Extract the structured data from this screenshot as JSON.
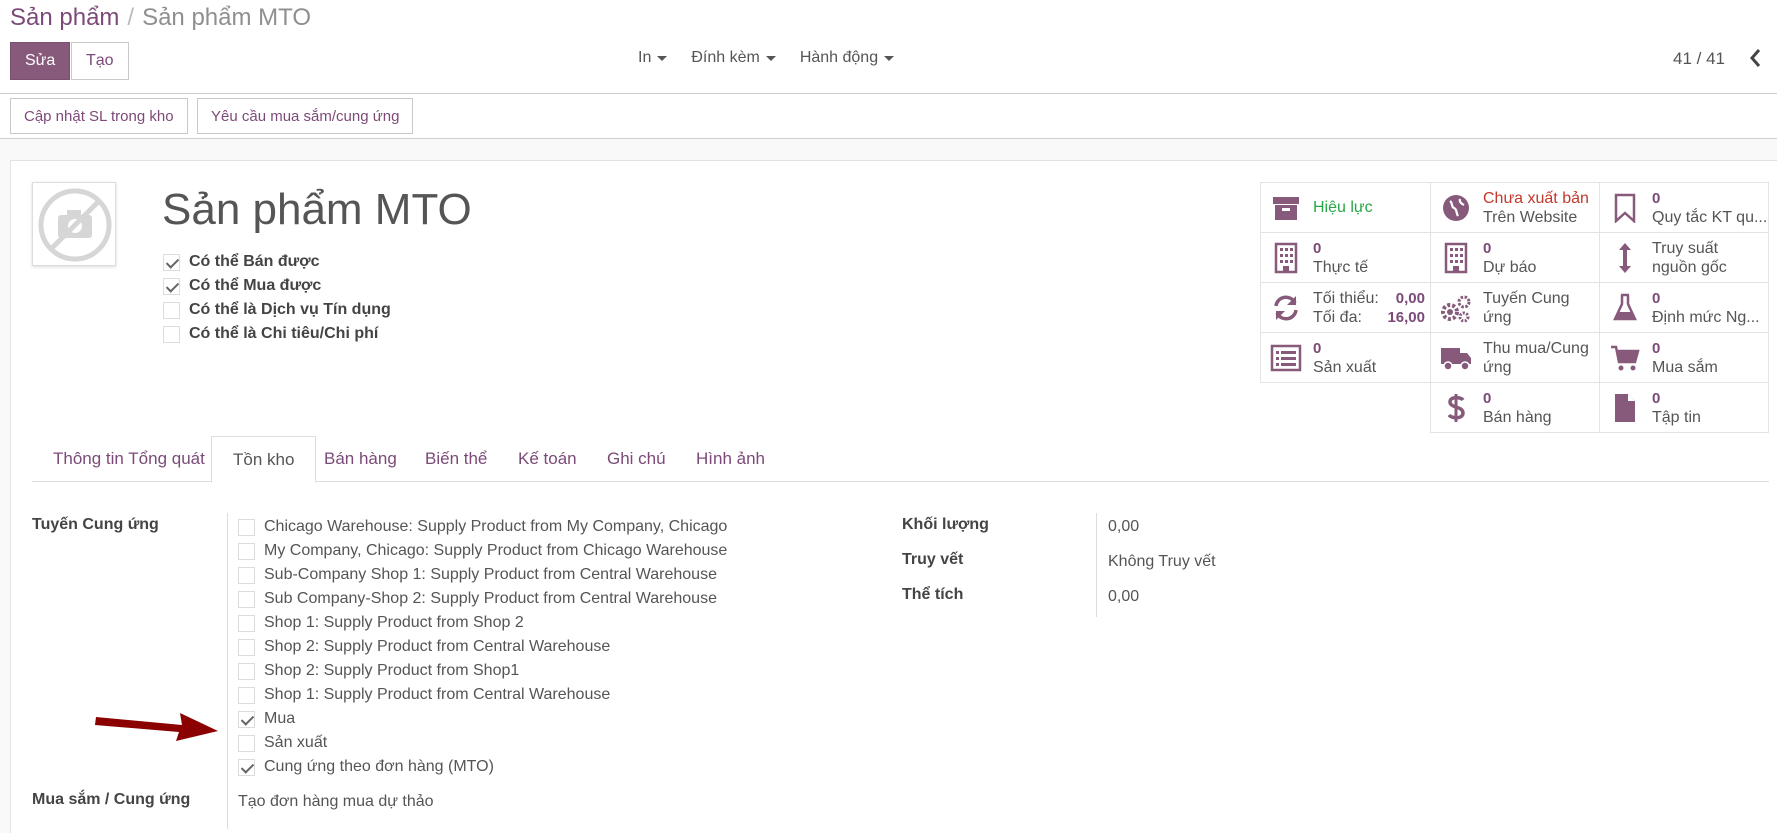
{
  "breadcrumb": {
    "parent": "Sản phẩm",
    "separator": "/",
    "current": "Sản phẩm MTO"
  },
  "toolbar": {
    "edit_label": "Sửa",
    "create_label": "Tạo"
  },
  "dropdowns": {
    "print": "In",
    "attachment": "Đính kèm",
    "action": "Hành động"
  },
  "pager": {
    "text": "41 / 41"
  },
  "status_buttons": {
    "update_qty": "Cập nhật SL trong kho",
    "procurement_request": "Yêu cầu mua sắm/cung ứng"
  },
  "product": {
    "name": "Sản phẩm MTO",
    "options": [
      {
        "label": "Có thể Bán được",
        "checked": true
      },
      {
        "label": "Có thể Mua được",
        "checked": true
      },
      {
        "label": "Có thể là Dịch vụ Tín dụng",
        "checked": false
      },
      {
        "label": "Có thể là Chi tiêu/Chi phí",
        "checked": false
      }
    ]
  },
  "smart_buttons": {
    "active": "Hiệu lực",
    "website_status": "Chưa xuất bản",
    "website_label": "Trên Website",
    "putaway_value": "0",
    "putaway_label": "Quy tắc KT qu...",
    "onhand_value": "0",
    "onhand_label": "Thực tế",
    "forecast_value": "0",
    "forecast_label": "Dự báo",
    "traceability_line1": "Truy suất",
    "traceability_line2": "nguồn gốc",
    "min_label": "Tối thiểu:",
    "min_value": "0,00",
    "max_label": "Tối đa:",
    "max_value": "16,00",
    "routes_line1": "Tuyến Cung",
    "routes_line2": "ứng",
    "bom_value": "0",
    "bom_label": "Định mức Ng...",
    "mo_value": "0",
    "mo_label": "Sản xuất",
    "purchase_line1": "Thu mua/Cung",
    "purchase_line2": "ứng",
    "po_value": "0",
    "po_label": "Mua sắm",
    "sales_value": "0",
    "sales_label": "Bán hàng",
    "docs_value": "0",
    "docs_label": "Tập tin"
  },
  "tabs": [
    "Thông tin Tổng quát",
    "Tồn kho",
    "Bán hàng",
    "Biến thể",
    "Kế toán",
    "Ghi chú",
    "Hình ảnh"
  ],
  "inventory": {
    "routes_label": "Tuyến Cung ứng",
    "routes": [
      {
        "label": "Chicago Warehouse: Supply Product from My Company, Chicago",
        "checked": false
      },
      {
        "label": "My Company, Chicago: Supply Product from Chicago Warehouse",
        "checked": false
      },
      {
        "label": "Sub-Company Shop 1: Supply Product from Central Warehouse",
        "checked": false
      },
      {
        "label": "Sub Company-Shop 2: Supply Product from Central Warehouse",
        "checked": false
      },
      {
        "label": "Shop 1: Supply Product from Shop 2",
        "checked": false
      },
      {
        "label": "Shop 2: Supply Product from Central Warehouse",
        "checked": false
      },
      {
        "label": "Shop 2: Supply Product from Shop1",
        "checked": false
      },
      {
        "label": "Shop 1: Supply Product from Central Warehouse",
        "checked": false
      },
      {
        "label": "Mua",
        "checked": true
      },
      {
        "label": "Sản xuất",
        "checked": false
      },
      {
        "label": "Cung ứng theo đơn hàng (MTO)",
        "checked": true
      }
    ],
    "procurement_label": "Mua sắm / Cung ứng",
    "procurement_value": "Tạo đơn hàng mua dự thảo",
    "weight_label": "Khối lượng",
    "weight_value": "0,00",
    "tracking_label": "Truy vết",
    "tracking_value": "Không Truy vết",
    "volume_label": "Thể tích",
    "volume_value": "0,00"
  },
  "colors": {
    "brand": "#875a7b",
    "link": "#7c4a78",
    "success": "#28a745",
    "danger": "#c0392b",
    "annotation_arrow": "#8b0000"
  }
}
